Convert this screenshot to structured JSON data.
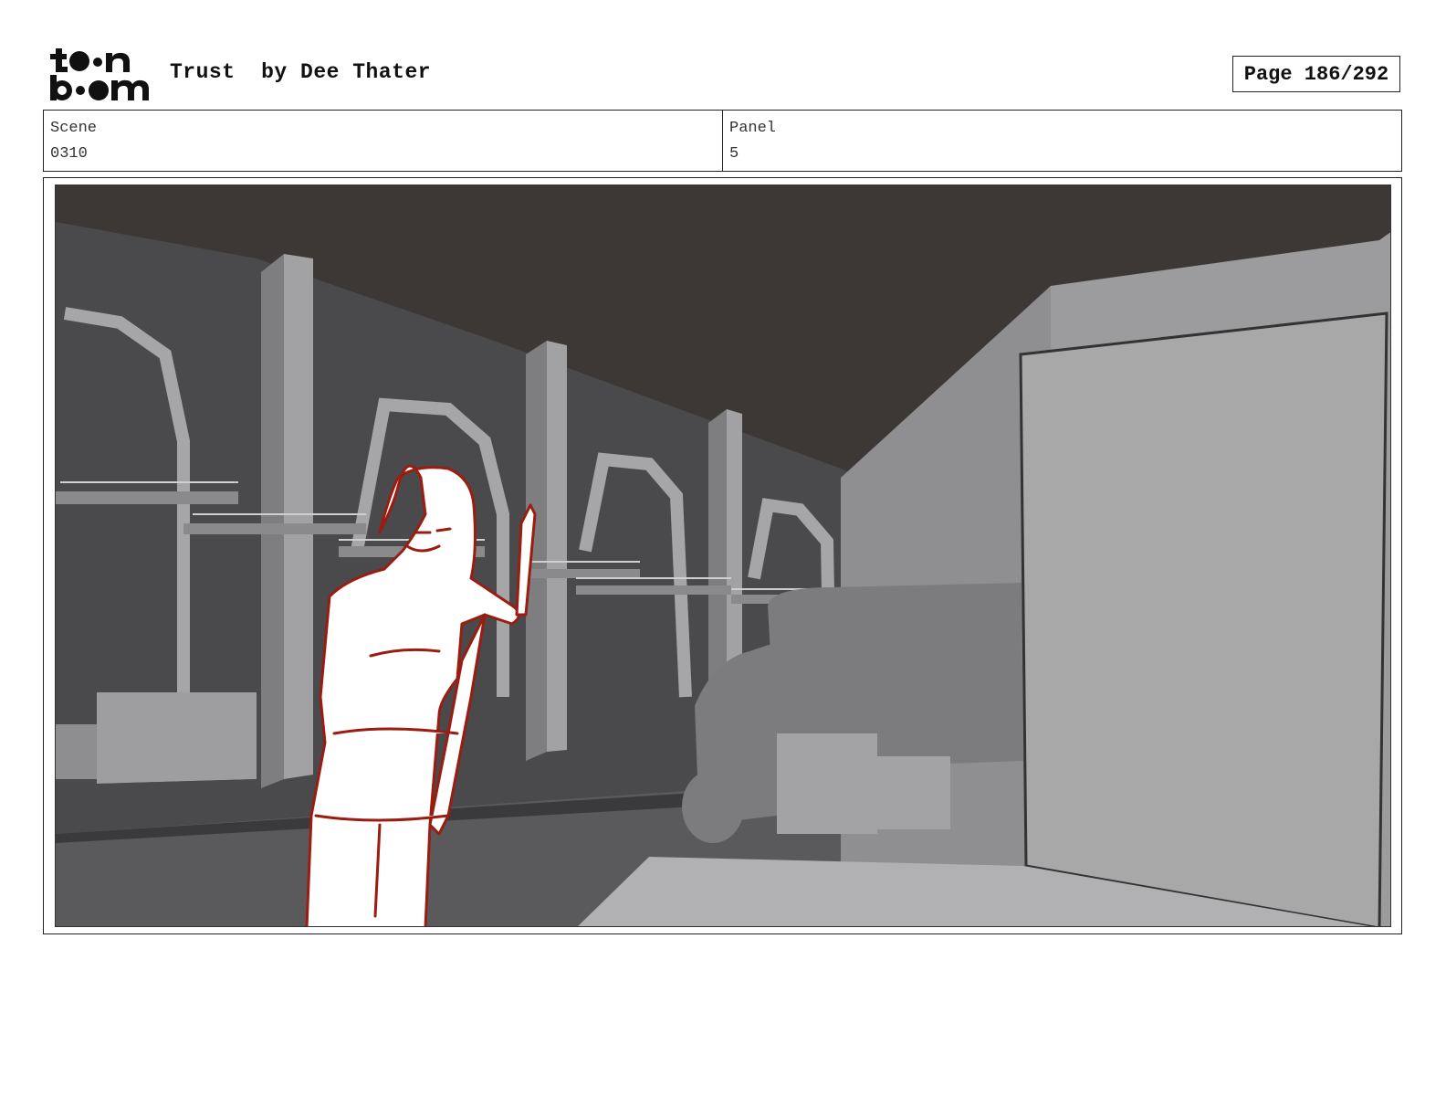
{
  "header": {
    "logo_top": "to•n",
    "logo_bottom": "b••m",
    "project_title": "Trust",
    "author": "by Dee Thater",
    "page_label": "Page 186/292"
  },
  "info": {
    "scene_label": "Scene",
    "scene_value": "0310",
    "panel_label": "Panel",
    "panel_value": "5"
  },
  "colors": {
    "sketch_line": "#9b1c10",
    "ceiling": "#3c3836",
    "wall": "#4a4a4d",
    "truck": "#a8a8a8"
  }
}
